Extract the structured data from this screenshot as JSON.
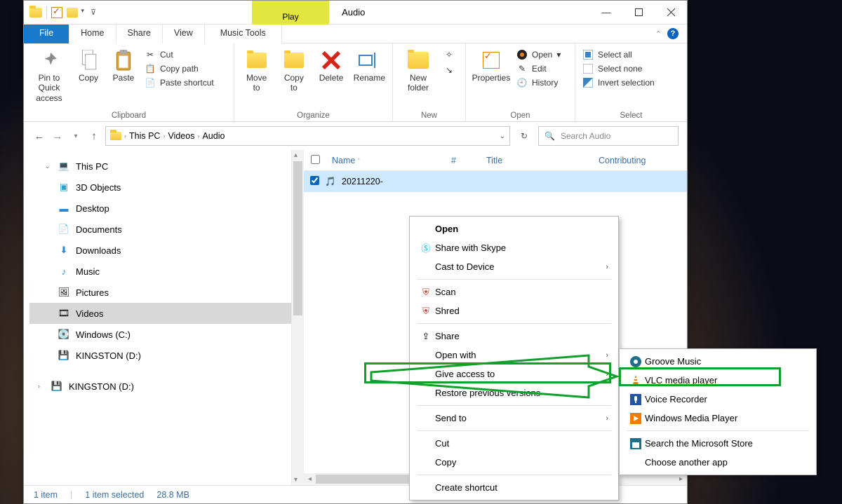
{
  "window": {
    "app_title": "Audio",
    "play_tab": "Play",
    "music_tools": "Music Tools",
    "tabs": {
      "file": "File",
      "home": "Home",
      "share": "Share",
      "view": "View"
    }
  },
  "ribbon": {
    "clipboard": {
      "label": "Clipboard",
      "pin": "Pin to Quick\naccess",
      "copy": "Copy",
      "paste": "Paste",
      "cut": "Cut",
      "copy_path": "Copy path",
      "paste_shortcut": "Paste shortcut"
    },
    "organize": {
      "label": "Organize",
      "move_to": "Move\nto",
      "copy_to": "Copy\nto",
      "delete": "Delete",
      "rename": "Rename"
    },
    "new": {
      "label": "New",
      "new_folder": "New\nfolder",
      "new_item": "New item",
      "easy_access": "Easy access"
    },
    "open": {
      "label": "Open",
      "properties": "Properties",
      "open": "Open",
      "edit": "Edit",
      "history": "History"
    },
    "select": {
      "label": "Select",
      "select_all": "Select all",
      "select_none": "Select none",
      "invert": "Invert selection"
    }
  },
  "address": {
    "this_pc": "This PC",
    "videos": "Videos",
    "audio": "Audio",
    "search_placeholder": "Search Audio"
  },
  "tree": {
    "this_pc": "This PC",
    "objects3d": "3D Objects",
    "desktop": "Desktop",
    "documents": "Documents",
    "downloads": "Downloads",
    "music": "Music",
    "pictures": "Pictures",
    "videos": "Videos",
    "windows_c": "Windows (C:)",
    "kingston_d": "KINGSTON (D:)",
    "kingston_d2": "KINGSTON (D:)"
  },
  "columns": {
    "name": "Name",
    "num": "#",
    "title": "Title",
    "contrib": "Contributing"
  },
  "file": {
    "name": "20211220-"
  },
  "status": {
    "items": "1 item",
    "selected": "1 item selected",
    "size": "28.8 MB"
  },
  "ctx": {
    "open": "Open",
    "skype": "Share with Skype",
    "cast": "Cast to Device",
    "scan": "Scan",
    "shred": "Shred",
    "share": "Share",
    "open_with": "Open with",
    "give_access": "Give access to",
    "restore": "Restore previous versions",
    "send_to": "Send to",
    "cut": "Cut",
    "copy": "Copy",
    "create_shortcut": "Create shortcut"
  },
  "submenu": {
    "groove": "Groove Music",
    "vlc": "VLC media player",
    "voice": "Voice Recorder",
    "wmp": "Windows Media Player",
    "store": "Search the Microsoft Store",
    "other": "Choose another app"
  }
}
